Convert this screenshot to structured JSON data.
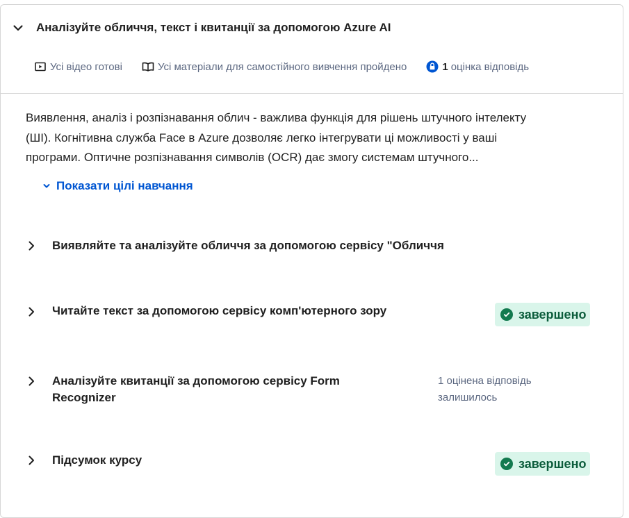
{
  "course": {
    "title": "Аналізуйте обличчя, текст і квитанції за допомогою Azure AI",
    "meta": {
      "videos": "Усі відео готові",
      "readings": "Усі матеріали для самостійного вивчення пройдено",
      "assessment_count": "1",
      "assessment_label": "оцінка відповідь"
    },
    "description_lines": [
      "Виявлення, аналіз і розпізнавання облич - важлива функція для рішень штучного інтелекту",
      "(ШІ). Когнітивна служба Face в Azure дозволяє легко інтегрувати ці можливості у ваші",
      "програми. Оптичне розпізнавання символів (OCR) дає змогу системам штучного..."
    ],
    "show_goals_label": "Показати цілі навчання"
  },
  "modules": [
    {
      "title_lines": [
        "Виявляйте та аналізуйте обличчя за допомогою сервісу \"Обличчя"
      ],
      "status": ""
    },
    {
      "title_lines": [
        "Читайте текст за допомогою сервісу комп'ютерного зору"
      ],
      "status": "завершено"
    },
    {
      "title_lines": [
        "Аналізуйте квитанції за допомогою сервісу Form",
        "Recognizer"
      ],
      "status": "",
      "remaining_lines": [
        "1 оцінена відповідь",
        "залишилось"
      ]
    },
    {
      "title_lines": [
        "Підсумок курсу"
      ],
      "status": "завершено"
    }
  ],
  "colors": {
    "link_blue": "#0056d2",
    "complete_bg": "#d9f5ea",
    "complete_green": "#137a4f",
    "muted_text": "#5b6780"
  },
  "icons": [
    "chevron-down-icon",
    "video-icon",
    "book-icon",
    "lock-icon",
    "chevron-right-icon",
    "check-circle-icon"
  ]
}
